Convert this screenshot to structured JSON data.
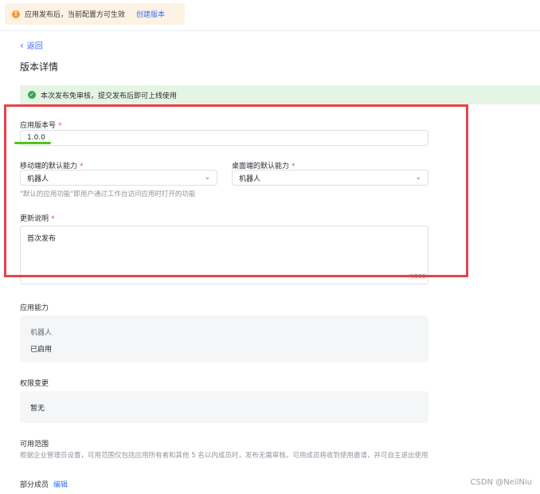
{
  "notice": {
    "icon": "warning-icon",
    "text": "应用发布后，当前配置方可生效",
    "link": "创建版本",
    "color": "#fdf2e3"
  },
  "nav": {
    "back_label": "返回"
  },
  "page": {
    "title": "版本详情"
  },
  "success_banner": {
    "icon": "check-circle-icon",
    "text": "本次发布免审核，提交发布后即可上线使用",
    "color": "#e4f5e3"
  },
  "form": {
    "version": {
      "label": "应用版本号",
      "required": "*",
      "value": "1.0.0"
    },
    "mobile_default": {
      "label": "移动端的默认能力",
      "required": "*",
      "value": "机器人"
    },
    "desktop_default": {
      "label": "桌面端的默认能力",
      "required": "*",
      "value": "机器人"
    },
    "default_hint": "\"默认的应用功能\"即用户通过工作台访问应用时打开的功能",
    "changelog": {
      "label": "更新说明",
      "required": "*",
      "value": "首次发布",
      "counter": "4/500"
    }
  },
  "capabilities": {
    "title": "应用能力",
    "item_name": "机器人",
    "item_status": "已启用"
  },
  "permissions": {
    "title": "权限变更",
    "value": "暂无"
  },
  "availability": {
    "title": "可用范围",
    "description": "根据企业管理员设置，可用范围仅包括应用所有者和其他 5 名以内成员时，发布无需审核。可用成员将收到使用邀请，并可自主退出使用",
    "scope": "部分成员",
    "edit_link": "编辑"
  },
  "watermark": "CSDN @NeilNiu",
  "annotation_color": "#e8424a"
}
